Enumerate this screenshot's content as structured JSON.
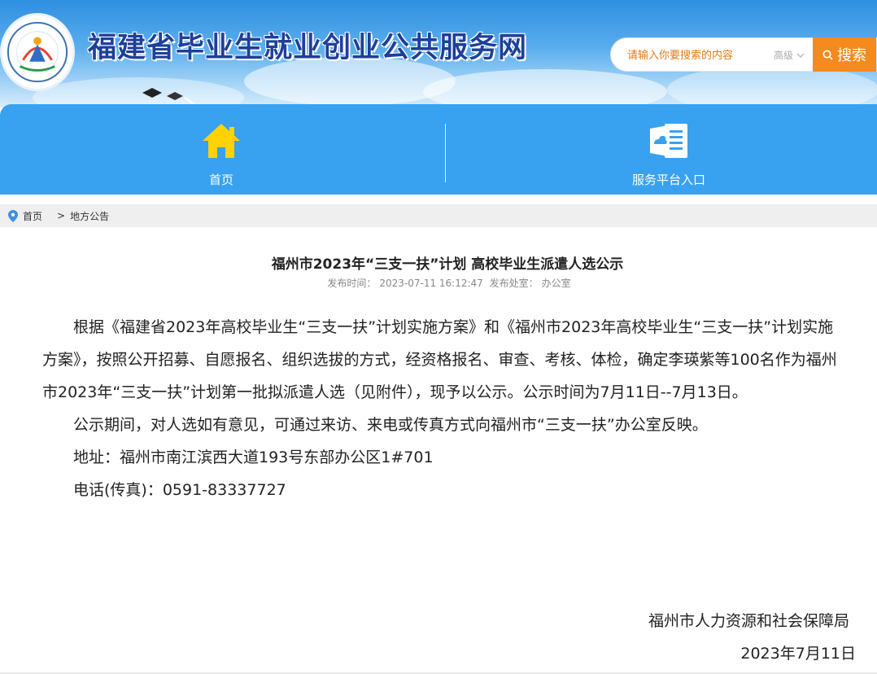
{
  "site": {
    "title": "福建省毕业生就业创业公共服务网",
    "logo_icon": "site-logo-emblem"
  },
  "search": {
    "placeholder": "请输入你要搜索的内容",
    "advanced_label": "高级",
    "button_label": "搜索",
    "accent_color": "#f58a1f"
  },
  "nav": {
    "items": [
      {
        "label": "首页",
        "icon": "home-icon"
      },
      {
        "label": "服务平台入口",
        "icon": "document-cloud-icon"
      }
    ],
    "background": "#39a2f0"
  },
  "breadcrumb": {
    "home": "首页",
    "separator": ">",
    "current": "地方公告"
  },
  "article": {
    "title": "福州市2023年“三支一扶”计划 高校毕业生派遣人选公示",
    "publish_label": "发布时间：",
    "publish_time": "2023-07-11 16:12:47",
    "office_label": "发布处室：",
    "office": "办公室",
    "paragraphs": [
      "根据《福建省2023年高校毕业生“三支一扶”计划实施方案》和《福州市2023年高校毕业生“三支一扶”计划实施方案》，按照公开招募、自愿报名、组织选拔的方式，经资格报名、审查、考核、体检，确定李瑛紫等100名作为福州市2023年“三支一扶”计划第一批拟派遣人选（见附件），现予以公示。公示时间为7月11日--7月13日。",
      "公示期间，对人选如有意见，可通过来访、来电或传真方式向福州市“三支一扶”办公室反映。",
      "地址：福州市南江滨西大道193号东部办公区1#701",
      "电话(传真)：0591-83337727"
    ],
    "signature_org": "福州市人力资源和社会保障局",
    "signature_date": "2023年7月11日"
  }
}
